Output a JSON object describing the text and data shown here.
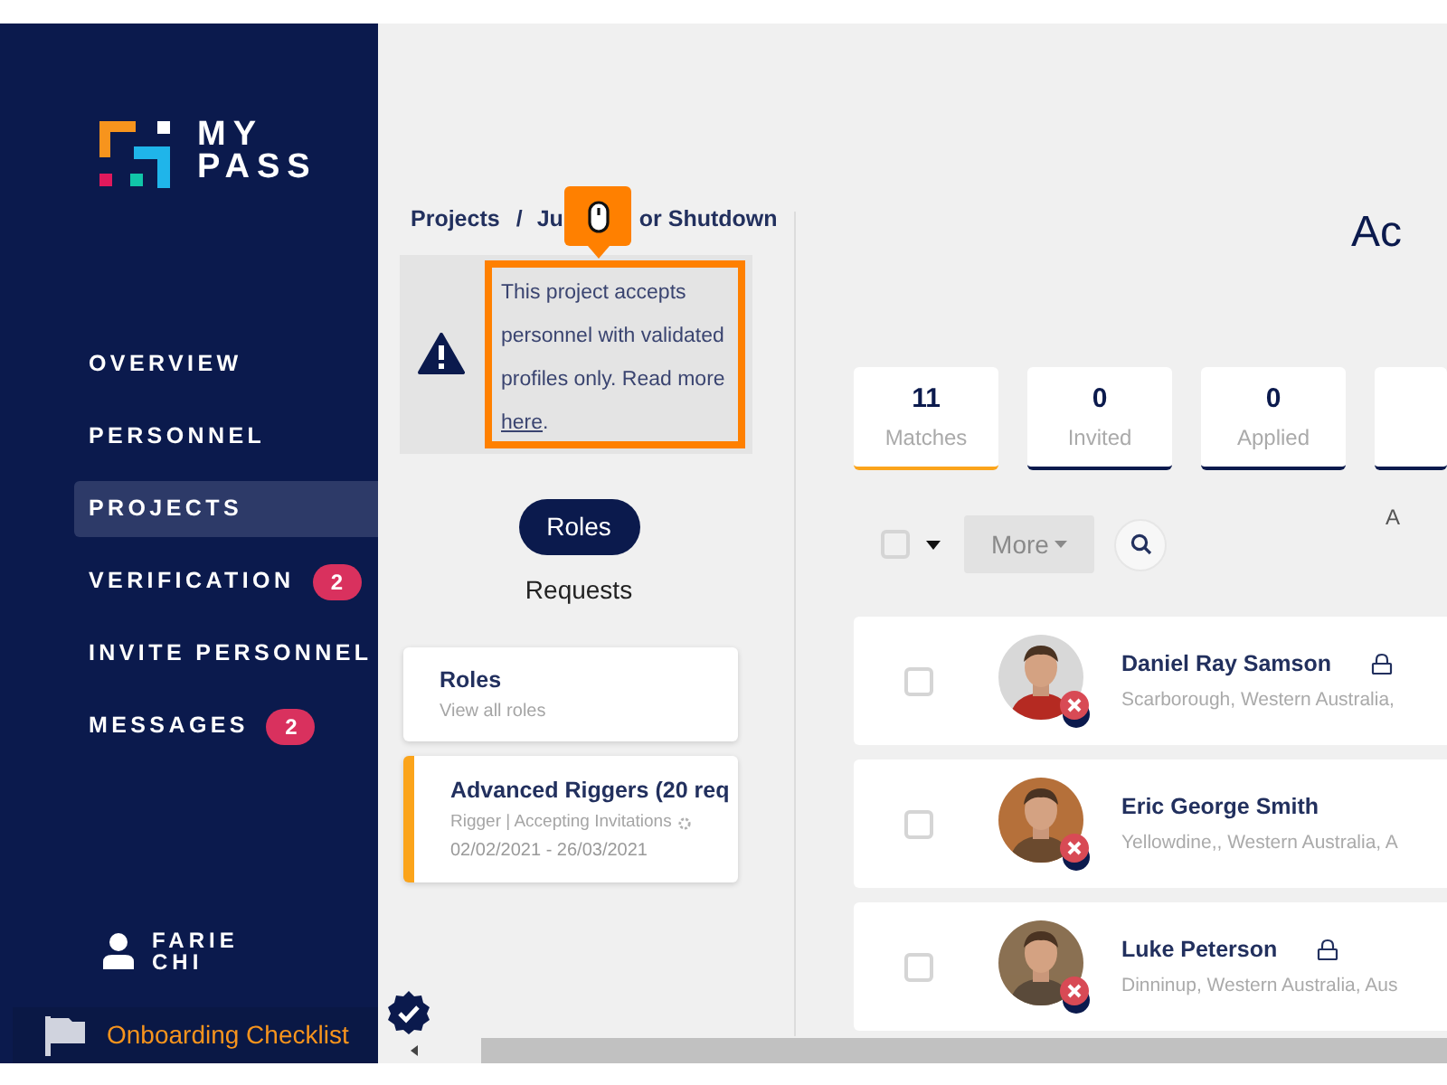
{
  "logo": {
    "line_1": "MY",
    "line_2": "PASS"
  },
  "nav": [
    {
      "label": "OVERVIEW",
      "selected": false
    },
    {
      "label": "PERSONNEL",
      "selected": false
    },
    {
      "label": "PROJECTS",
      "selected": true
    },
    {
      "label": "VERIFICATION",
      "selected": false,
      "badge": "2"
    },
    {
      "label": "INVITE PERSONNEL",
      "selected": false
    },
    {
      "label": "MESSAGES",
      "selected": false,
      "badge": "2"
    }
  ],
  "user": {
    "name_line_1": "FARIE",
    "name_line_2": "CHI"
  },
  "onboarding": {
    "label": "Onboarding Checklist"
  },
  "breadcrumb": {
    "root": "Projects",
    "separator": "/",
    "current_start": "Ju",
    "current_end": "or Shutdown"
  },
  "notice": {
    "text": "This project accepts personnel with validated profiles only. Read more",
    "link": "here",
    "end": "."
  },
  "roles_button": "Roles",
  "requests_label": "Requests",
  "role_cards": [
    {
      "title": "Roles",
      "subtitle": "View all roles",
      "selected": false
    },
    {
      "title": "Advanced Riggers (20 req",
      "meta": "Rigger | Accepting Invitations",
      "dates": "02/02/2021 - 26/03/2021",
      "selected": true
    }
  ],
  "heading": "Ac",
  "stats": [
    {
      "value": "11",
      "label": "Matches",
      "selected": true
    },
    {
      "value": "0",
      "label": "Invited",
      "selected": false
    },
    {
      "value": "0",
      "label": "Applied",
      "selected": false
    }
  ],
  "toolbar": {
    "more_button": "More",
    "edge_label": "A",
    "select_all_checked": false
  },
  "people": [
    {
      "name": "Daniel Ray Samson",
      "location": "Scarborough, Western Australia,",
      "locked": true,
      "checked": false
    },
    {
      "name": "Eric George Smith",
      "location": "Yellowdine,, Western Australia, A",
      "locked": false,
      "checked": false
    },
    {
      "name": "Luke Peterson",
      "location": "Dinninup, Western Australia, Aus",
      "locked": true,
      "checked": false
    }
  ]
}
